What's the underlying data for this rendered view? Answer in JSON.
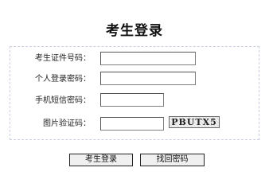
{
  "page": {
    "title": "考生登录"
  },
  "form": {
    "exam_id": {
      "label": "考生证件号码：",
      "value": ""
    },
    "password": {
      "label": "个人登录密码：",
      "value": ""
    },
    "sms_password": {
      "label": "手机短信密码：",
      "value": ""
    },
    "captcha": {
      "label": "图片验证码：",
      "value": "",
      "image_text": "PBUTX5"
    }
  },
  "buttons": {
    "login": "考生登录",
    "recover": "找回密码"
  }
}
